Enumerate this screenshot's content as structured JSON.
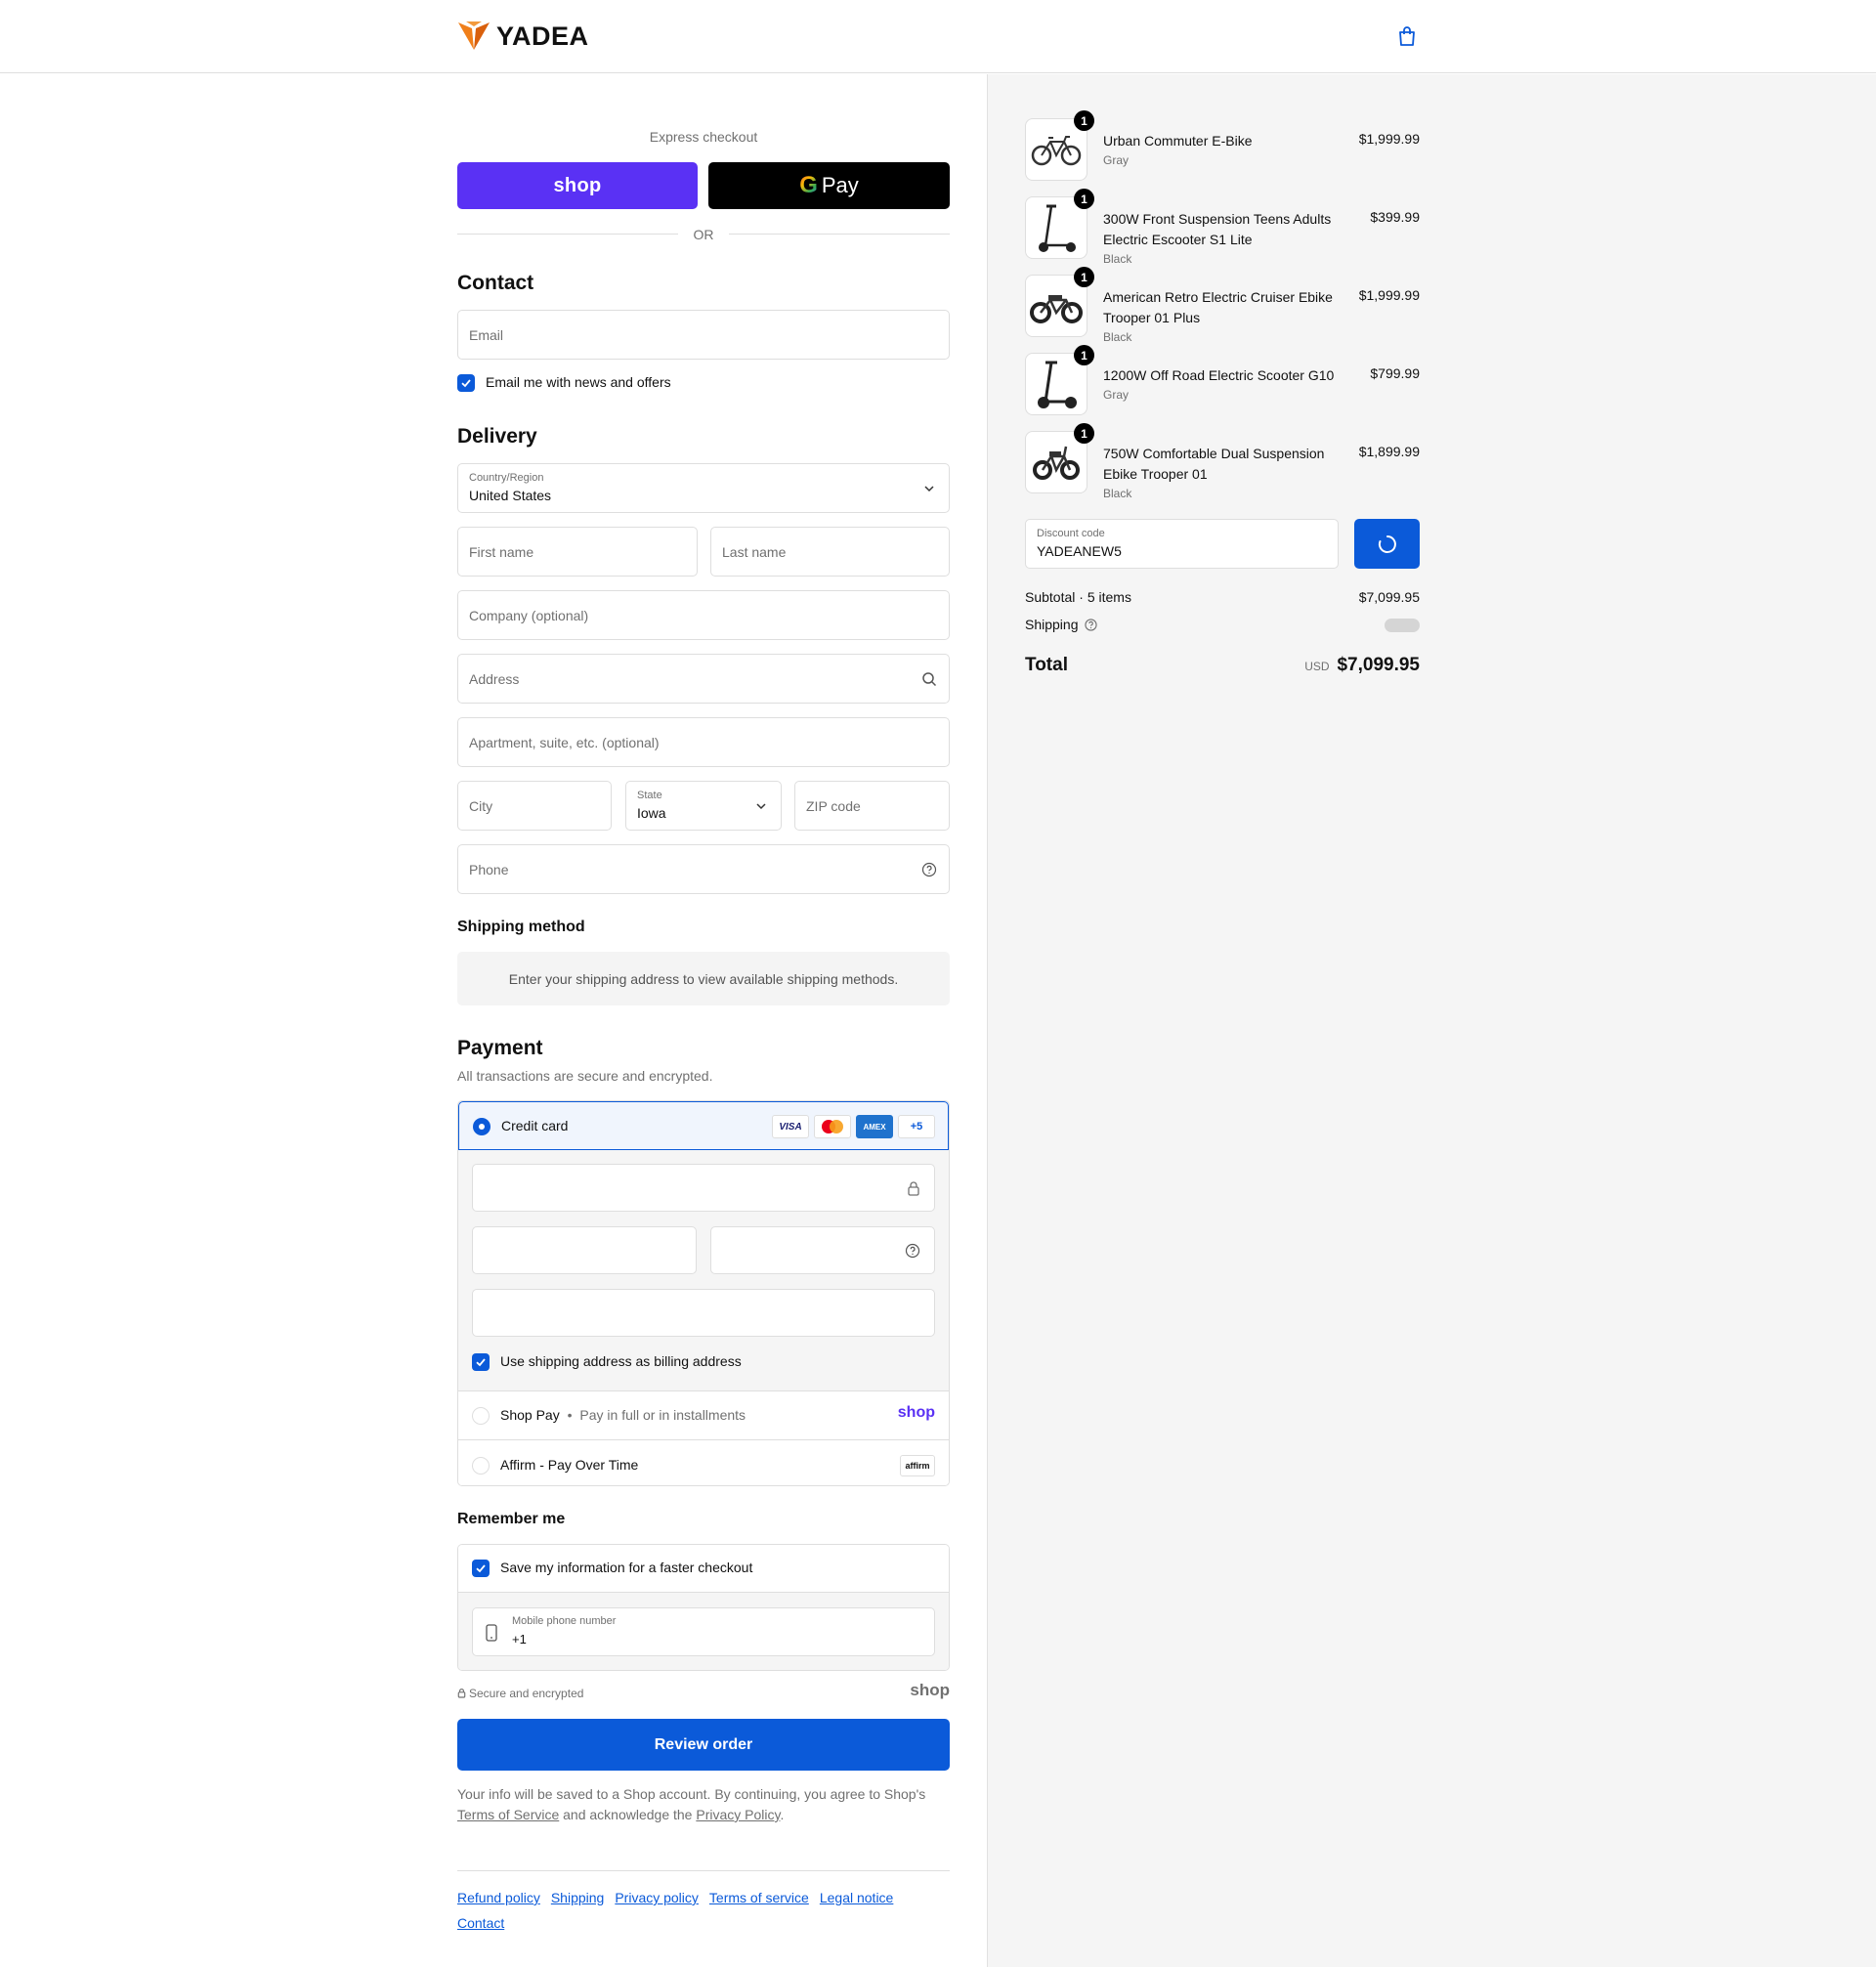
{
  "brand": {
    "name": "YADEA",
    "accent": "#f07f1a"
  },
  "colors": {
    "primary": "#0b5ad9",
    "shop_purple": "#5a31f4"
  },
  "express": {
    "label": "Express checkout",
    "shop_label": "shop",
    "gpay_label": "Pay",
    "or": "OR"
  },
  "contact": {
    "heading": "Contact",
    "email_placeholder": "Email",
    "news_opt_in": {
      "label": "Email me with news and offers",
      "checked": true
    }
  },
  "delivery": {
    "heading": "Delivery",
    "country_label": "Country/Region",
    "country_value": "United States",
    "first_name": "First name",
    "last_name": "Last name",
    "company": "Company (optional)",
    "address": "Address",
    "apartment": "Apartment, suite, etc. (optional)",
    "city": "City",
    "state_label": "State",
    "state_value": "Iowa",
    "zip": "ZIP code",
    "phone": "Phone"
  },
  "shipping_method": {
    "heading": "Shipping method",
    "info": "Enter your shipping address to view available shipping methods."
  },
  "payment": {
    "heading": "Payment",
    "subtitle": "All transactions are secure and encrypted.",
    "credit_card_label": "Credit card",
    "card_logos": [
      "VISA",
      "mastercard",
      "AMEX",
      "+5"
    ],
    "billing_same": {
      "label": "Use shipping address as billing address",
      "checked": true
    },
    "shop_pay_label": "Shop Pay",
    "shop_pay_sep": "•",
    "shop_pay_desc": "Pay in full or in installments",
    "shop_pay_logo": "shop",
    "affirm_label": "Affirm - Pay Over Time",
    "affirm_logo": "affirm"
  },
  "remember": {
    "heading": "Remember me",
    "save_label": "Save my information for a faster checkout",
    "save_checked": true,
    "mobile_label": "Mobile phone number",
    "mobile_value": "+1"
  },
  "secure_note": "Secure and encrypted",
  "secure_logo": "shop",
  "review_button": "Review order",
  "legal": {
    "text1": "Your info will be saved to a Shop account. By continuing, you agree to Shop's",
    "tos": "Terms of Service",
    "text2": "and acknowledge the",
    "privacy": "Privacy Policy",
    "end": "."
  },
  "footer_links": [
    "Refund policy",
    "Shipping",
    "Privacy policy",
    "Terms of service",
    "Legal notice",
    "Contact"
  ],
  "cart": {
    "items": [
      {
        "name": "Urban Commuter E-Bike",
        "variant": "Gray",
        "price": "$1,999.99",
        "qty": "1",
        "icon": "bicycle-icon"
      },
      {
        "name": "300W Front Suspension Teens Adults Electric Escooter S1 Lite",
        "variant": "Black",
        "price": "$399.99",
        "qty": "1",
        "icon": "scooter-icon"
      },
      {
        "name": "American Retro Electric Cruiser Ebike Trooper 01 Plus",
        "variant": "Black",
        "price": "$1,999.99",
        "qty": "1",
        "icon": "ebike-icon"
      },
      {
        "name": "1200W Off Road Electric Scooter G10",
        "variant": "Gray",
        "price": "$799.99",
        "qty": "1",
        "icon": "scooter-icon"
      },
      {
        "name": "750W Comfortable Dual Suspension Ebike Trooper 01",
        "variant": "Black",
        "price": "$1,899.99",
        "qty": "1",
        "icon": "ebike-icon"
      }
    ],
    "discount_label": "Discount code",
    "discount_value": "YADEANEW5",
    "subtotal_label": "Subtotal · 5 items",
    "subtotal_value": "$7,099.95",
    "shipping_label": "Shipping",
    "total_label": "Total",
    "currency": "USD",
    "total_value": "$7,099.95"
  }
}
